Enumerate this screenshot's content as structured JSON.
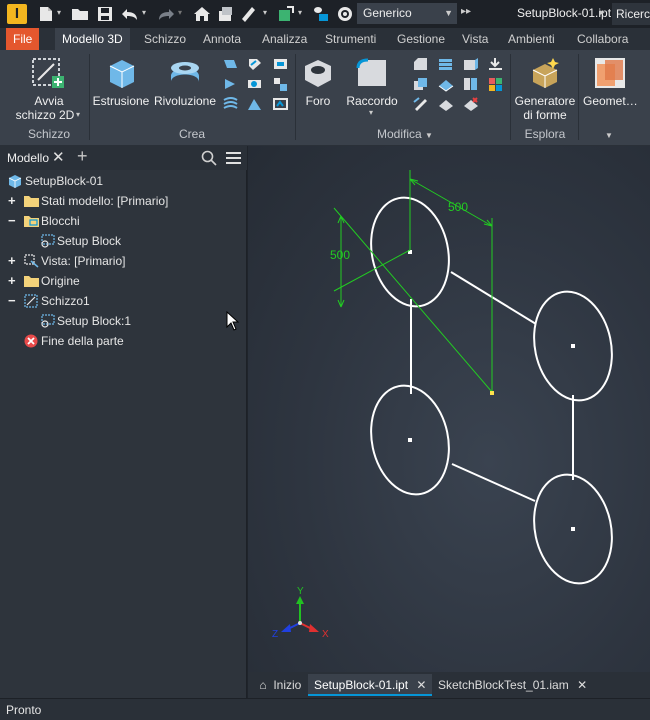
{
  "titlebar": {
    "app_letter": "I",
    "appearance_value": "Generico",
    "document_title": "SetupBlock-01.ipt",
    "search_placeholder": "Ricerca"
  },
  "ribbon_tabs": [
    "File",
    "Modello 3D",
    "Schizzo",
    "Annota",
    "Analizza",
    "Strumenti",
    "Gestione",
    "Vista",
    "Ambienti",
    "Collabora"
  ],
  "active_tab": "Modello 3D",
  "ribbon": {
    "sketch_panel": {
      "button": "Avvia schizzo 2D",
      "line1": "Avvia",
      "line2": "schizzo 2D",
      "label": "Schizzo"
    },
    "create_panel": {
      "extrude": "Estrusione",
      "revolve": "Rivoluzione",
      "label": "Crea"
    },
    "modify_panel": {
      "hole": "Foro",
      "fillet": "Raccordo",
      "label": "Modifica"
    },
    "explore_panel": {
      "line1": "Generatore",
      "line2": "di forme",
      "label": "Esplora"
    },
    "geometry_button": "Geometria"
  },
  "browser": {
    "tab_label": "Modello",
    "tree": [
      {
        "label": "SetupBlock-01",
        "expander": ""
      },
      {
        "label": "Stati modello: [Primario]",
        "expander": "+"
      },
      {
        "label": "Blocchi",
        "expander": "−"
      },
      {
        "label": "Setup Block",
        "expander": ""
      },
      {
        "label": "Vista: [Primario]",
        "expander": "+"
      },
      {
        "label": "Origine",
        "expander": "+"
      },
      {
        "label": "Schizzo1",
        "expander": "−"
      },
      {
        "label": "Setup Block:1",
        "expander": ""
      },
      {
        "label": "Fine della parte",
        "expander": ""
      }
    ]
  },
  "viewport": {
    "dim_horizontal": "500",
    "dim_vertical": "500",
    "triad": {
      "x": "X",
      "y": "Y",
      "z": "Z"
    },
    "colors": {
      "sketch": "#ffffff",
      "dimension": "#22cc22",
      "point": "#ffe14d",
      "x_axis": "#e03030",
      "y_axis": "#22c022",
      "z_axis": "#2040e0"
    }
  },
  "doc_tabs": [
    {
      "label": "Inizio",
      "closable": false
    },
    {
      "label": "SetupBlock-01.ipt",
      "closable": true
    },
    {
      "label": "SketchBlockTest_01.iam",
      "closable": true
    }
  ],
  "status": "Pronto"
}
